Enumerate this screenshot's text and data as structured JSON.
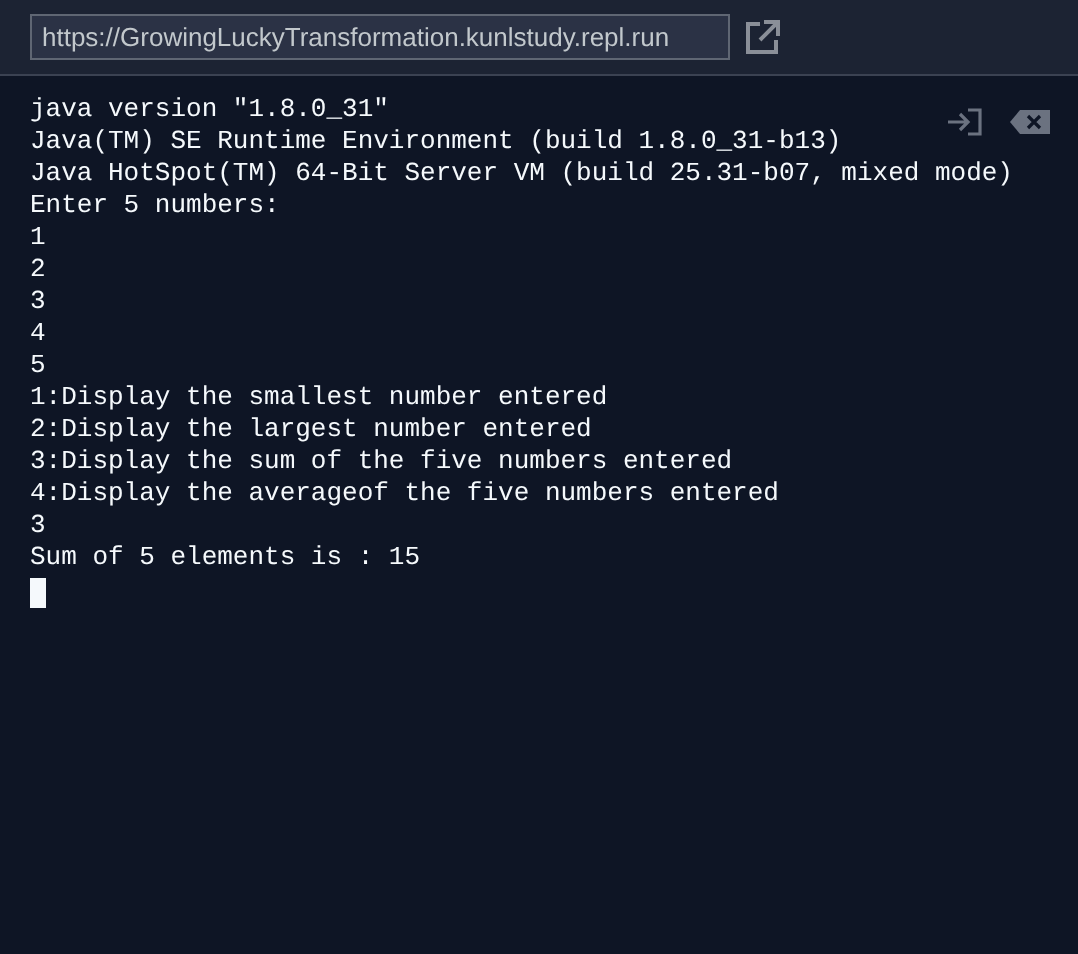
{
  "address_bar": {
    "url": "https://GrowingLuckyTransformation.kunlstudy.repl.run"
  },
  "console": {
    "lines": [
      "java version \"1.8.0_31\"",
      "Java(TM) SE Runtime Environment (build 1.8.0_31-b13)",
      "Java HotSpot(TM) 64-Bit Server VM (build 25.31-b07, mixed mode)",
      "Enter 5 numbers:",
      "1",
      "2",
      "3",
      "4",
      "5",
      "1:Display the smallest number entered",
      "2:Display the largest number entered",
      "3:Display the sum of the five numbers entered",
      "4:Display the averageof the five numbers entered",
      "3",
      "Sum of 5 elements is : 15"
    ]
  }
}
